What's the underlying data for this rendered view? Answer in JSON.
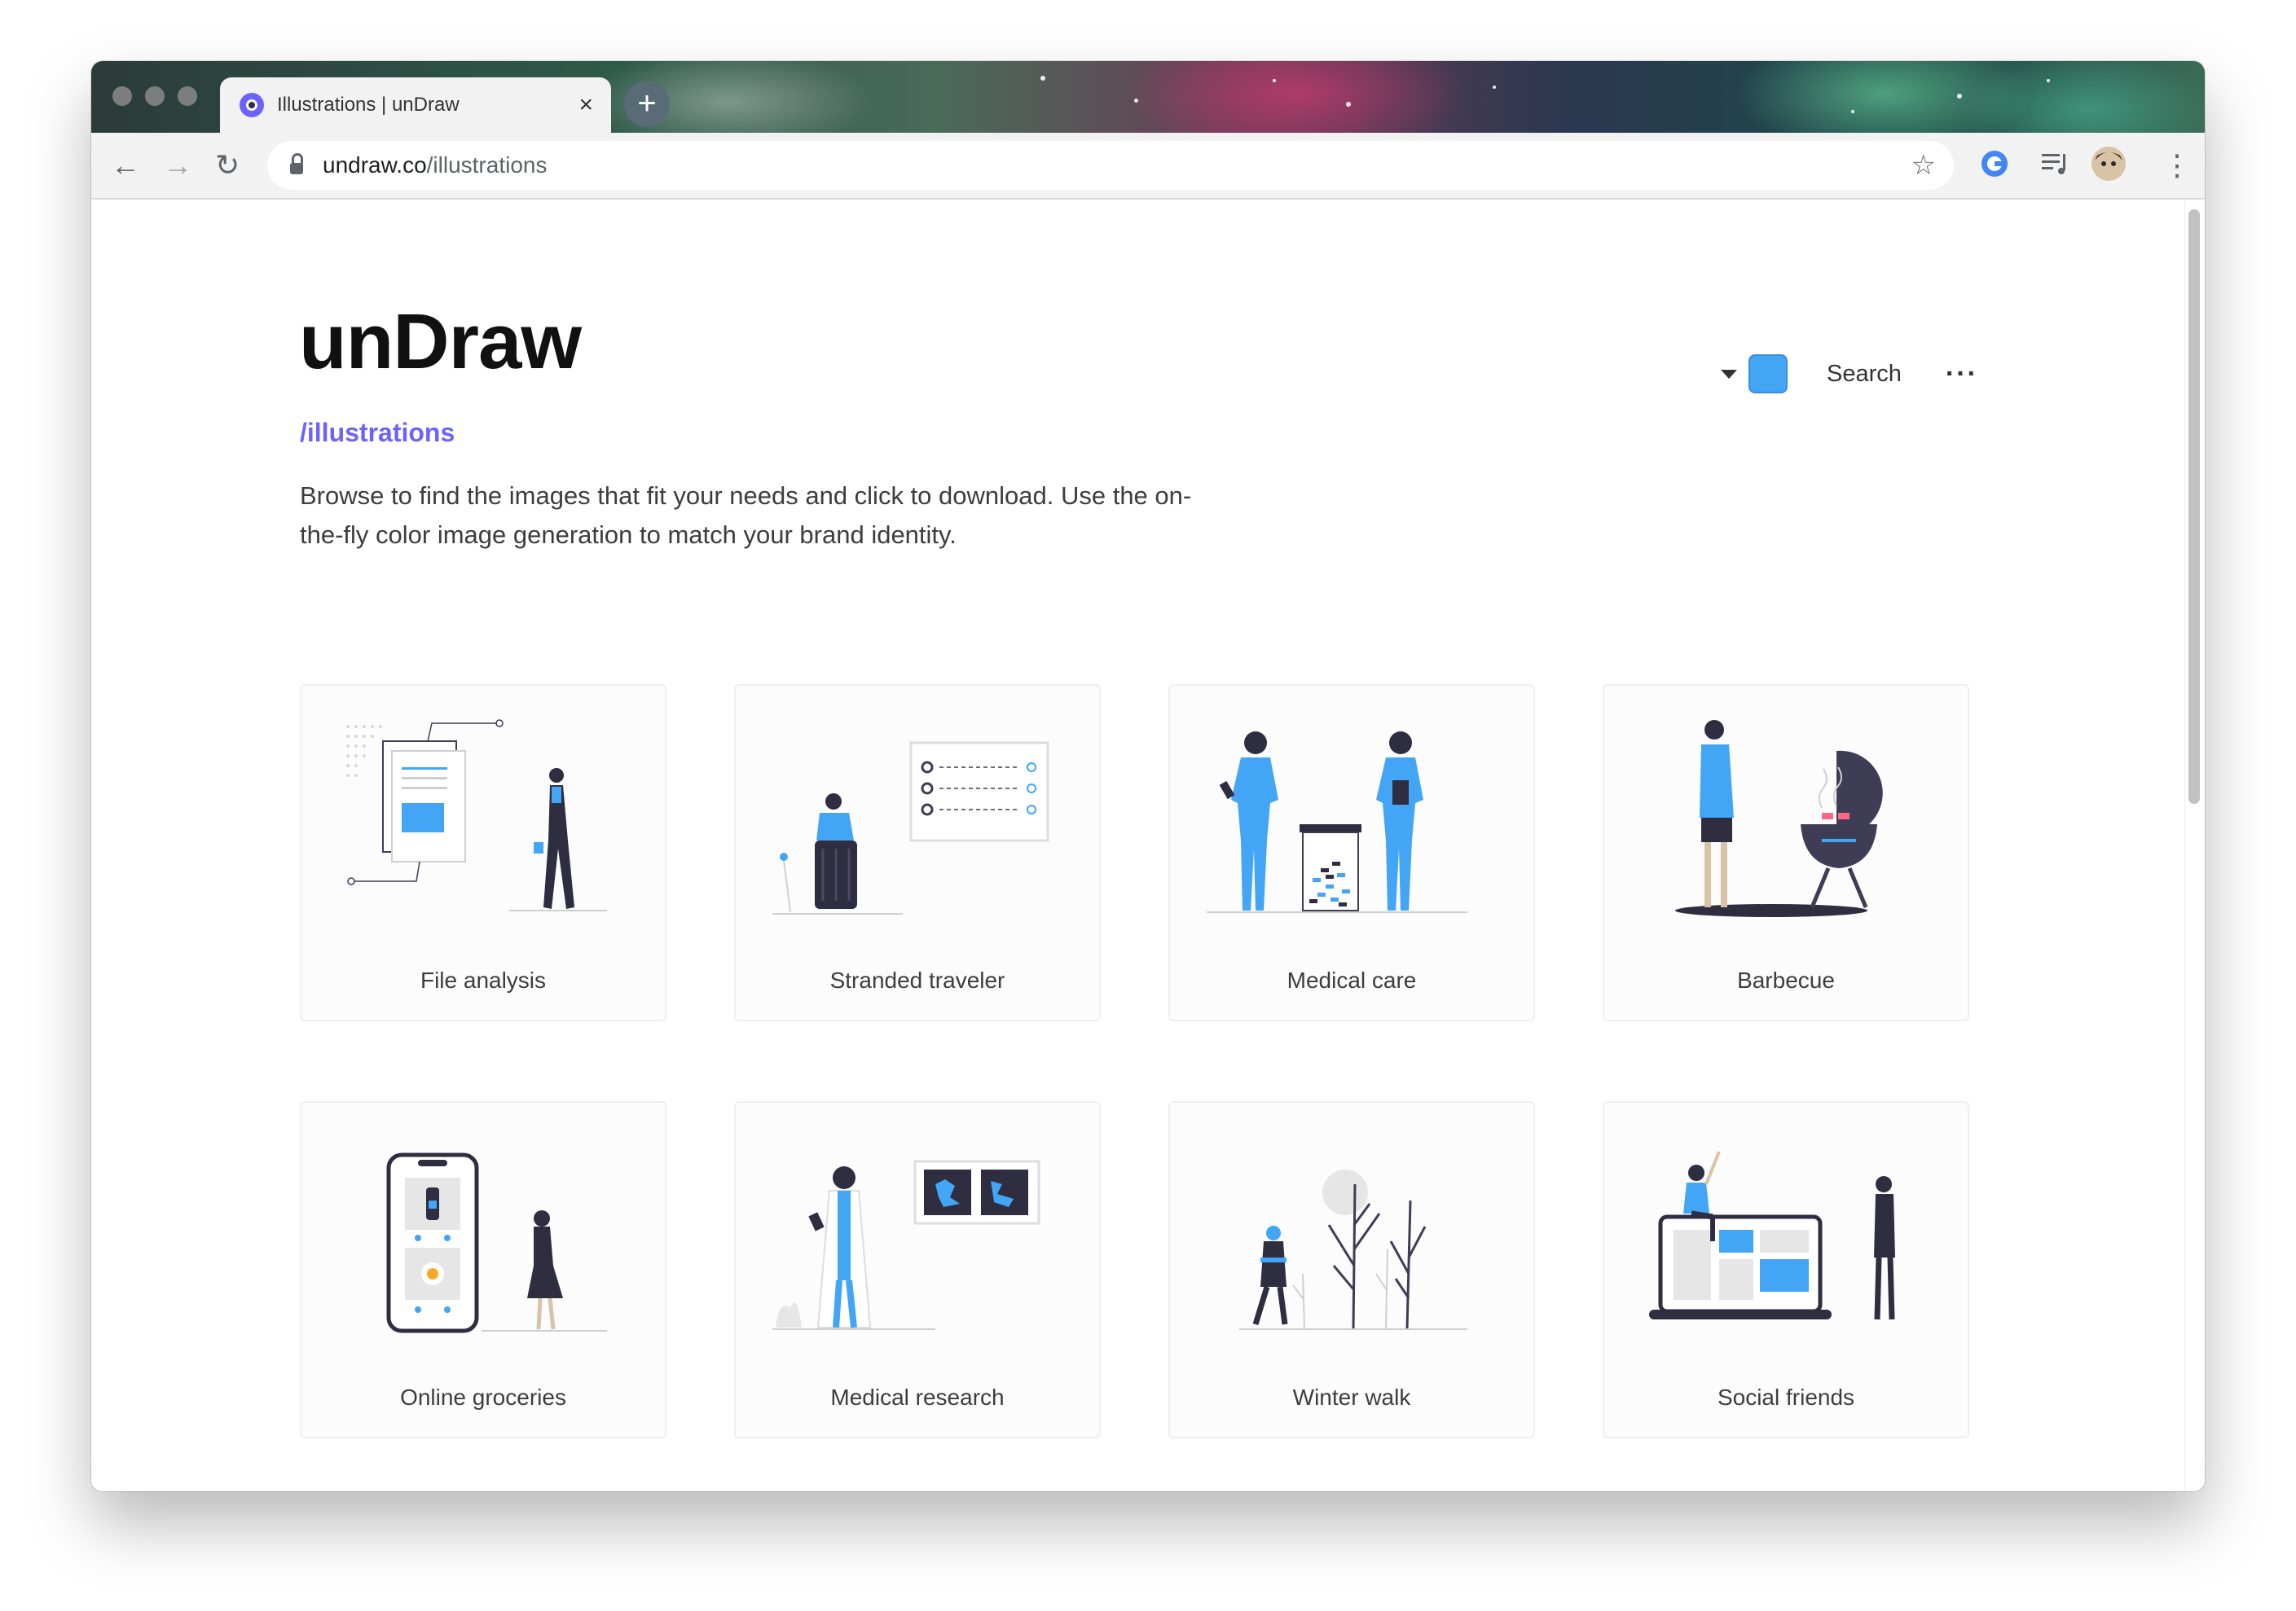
{
  "browser": {
    "tab_title": "Illustrations | unDraw",
    "tab_close": "×",
    "new_tab": "+",
    "url_domain": "undraw.co",
    "url_path": "/illustrations",
    "back": "←",
    "forward": "→",
    "reload": "↻",
    "bookmark": "☆",
    "menu": "⋮"
  },
  "header": {
    "logo": "unDraw",
    "subtitle": "/illustrations",
    "description": "Browse to find the images that fit your needs and click to download. Use the on-the-fly color image generation to match your brand identity.",
    "search_label": "Search",
    "more_label": "···",
    "accent_color": "#42a5f5",
    "brand_color": "#6c63ff"
  },
  "illustrations": [
    {
      "title": "File analysis",
      "icon": "file-analysis-illustration"
    },
    {
      "title": "Stranded traveler",
      "icon": "stranded-traveler-illustration"
    },
    {
      "title": "Medical care",
      "icon": "medical-care-illustration"
    },
    {
      "title": "Barbecue",
      "icon": "barbecue-illustration"
    },
    {
      "title": "Online groceries",
      "icon": "online-groceries-illustration"
    },
    {
      "title": "Medical research",
      "icon": "medical-research-illustration"
    },
    {
      "title": "Winter walk",
      "icon": "winter-walk-illustration"
    },
    {
      "title": "Social friends",
      "icon": "social-friends-illustration"
    }
  ]
}
